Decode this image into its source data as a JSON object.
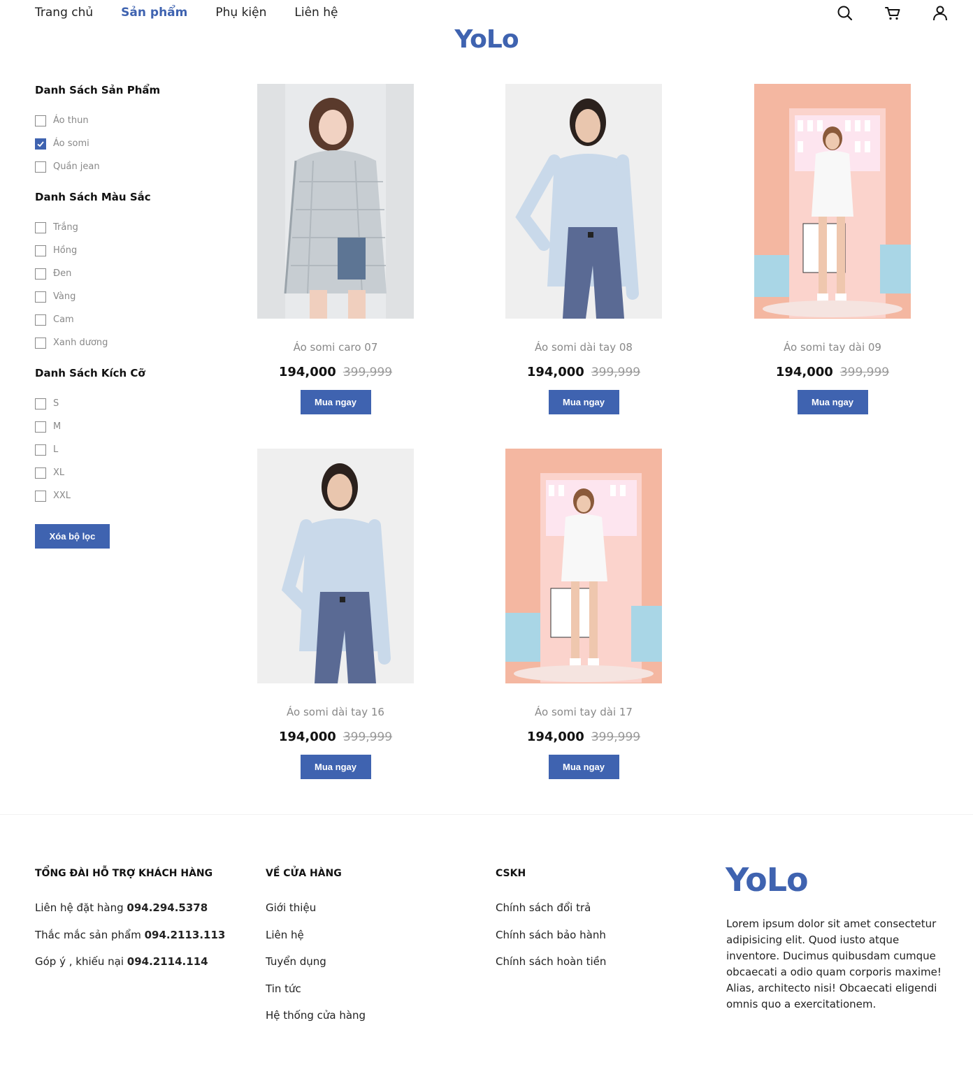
{
  "nav": {
    "items": [
      {
        "label": "Trang chủ"
      },
      {
        "label": "Sản phẩm"
      },
      {
        "label": "Phụ kiện"
      },
      {
        "label": "Liên hệ"
      }
    ],
    "active_index": 1
  },
  "brand": {
    "logo": "YoLo",
    "color": "#3f63b0"
  },
  "header_icons": [
    "search-icon",
    "cart-icon",
    "user-icon"
  ],
  "sidebar": {
    "groups": [
      {
        "title": "Danh Sách Sản Phẩm",
        "options": [
          {
            "label": "Áo thun",
            "checked": false
          },
          {
            "label": "Áo somi",
            "checked": true
          },
          {
            "label": "Quần jean",
            "checked": false
          }
        ]
      },
      {
        "title": "Danh Sách Màu Sắc",
        "options": [
          {
            "label": "Trắng",
            "checked": false
          },
          {
            "label": "Hồng",
            "checked": false
          },
          {
            "label": "Đen",
            "checked": false
          },
          {
            "label": "Vàng",
            "checked": false
          },
          {
            "label": "Cam",
            "checked": false
          },
          {
            "label": "Xanh dương",
            "checked": false
          }
        ]
      },
      {
        "title": "Danh Sách Kích Cỡ",
        "options": [
          {
            "label": "S",
            "checked": false
          },
          {
            "label": "M",
            "checked": false
          },
          {
            "label": "L",
            "checked": false
          },
          {
            "label": "XL",
            "checked": false
          },
          {
            "label": "XXL",
            "checked": false
          }
        ]
      }
    ],
    "clear_label": "Xóa bộ lọc"
  },
  "products": [
    {
      "name": "Áo somi caro 07",
      "price": "194,000",
      "old_price": "399,999",
      "buy_label": "Mua ngay",
      "photo": "plaid-shirt-photo"
    },
    {
      "name": "Áo somi dài tay 08",
      "price": "194,000",
      "old_price": "399,999",
      "buy_label": "Mua ngay",
      "photo": "blue-shirt-photo"
    },
    {
      "name": "Áo somi tay dài 09",
      "price": "194,000",
      "old_price": "399,999",
      "buy_label": "Mua ngay",
      "photo": "white-shirt-pink-bg-photo"
    },
    {
      "name": "Áo somi dài tay 16",
      "price": "194,000",
      "old_price": "399,999",
      "buy_label": "Mua ngay",
      "photo": "blue-shirt-photo"
    },
    {
      "name": "Áo somi tay dài 17",
      "price": "194,000",
      "old_price": "399,999",
      "buy_label": "Mua ngay",
      "photo": "white-shirt-pink-bg-photo"
    }
  ],
  "footer": {
    "support": {
      "title": "TỔNG ĐÀI HỖ TRỢ KHÁCH HÀNG",
      "lines": [
        {
          "label": "Liên hệ đặt hàng",
          "phone": "094.294.5378"
        },
        {
          "label": "Thắc mắc sản phẩm",
          "phone": "094.2113.113"
        },
        {
          "label": "Góp ý , khiếu nại",
          "phone": "094.2114.114"
        }
      ]
    },
    "store": {
      "title": "VỀ CỬA HÀNG",
      "links": [
        "Giới thiệu",
        "Liên hệ",
        "Tuyển dụng",
        "Tin tức",
        "Hệ thống cửa hàng"
      ]
    },
    "cskh": {
      "title": "CSKH",
      "links": [
        "Chính sách đổi trả",
        "Chính sách bảo hành",
        "Chính sách hoàn tiền"
      ]
    },
    "logo": "YoLo",
    "description": "Lorem ipsum dolor sit amet consectetur adipisicing elit. Quod iusto atque inventore. Ducimus quibusdam cumque obcaecati a odio quam corporis maxime! Alias, architecto nisi! Obcaecati eligendi omnis quo a exercitationem."
  }
}
